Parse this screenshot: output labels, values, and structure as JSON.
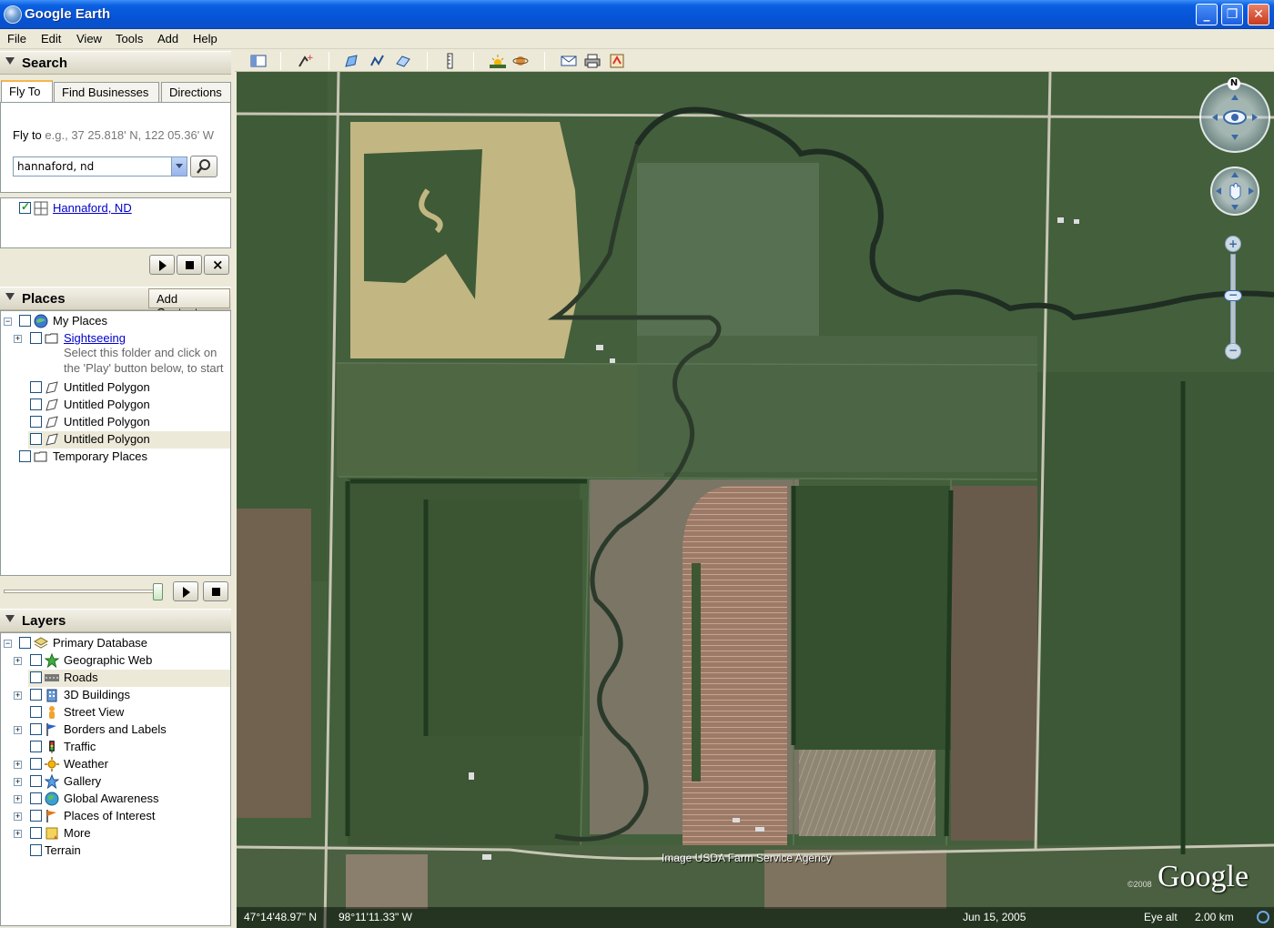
{
  "window": {
    "title": "Google Earth",
    "minimize": "_",
    "maximize": "❐",
    "close": "✕"
  },
  "menu": [
    "File",
    "Edit",
    "View",
    "Tools",
    "Add",
    "Help"
  ],
  "search": {
    "header": "Search",
    "tabs": [
      "Fly To",
      "Find Businesses",
      "Directions"
    ],
    "fly_to_label": "Fly to",
    "fly_to_hint": "e.g., 37 25.818' N, 122 05.36' W",
    "input_value": "hannaford, nd",
    "result": "Hannaford, ND"
  },
  "places": {
    "header": "Places",
    "add_content": "Add Content",
    "items": {
      "my_places": "My Places",
      "sightseeing": "Sightseeing",
      "sightseeing_desc_1": "Select this folder and click on",
      "sightseeing_desc_2": "the 'Play' button below, to start",
      "polygon_1": "Untitled Polygon",
      "polygon_2": "Untitled Polygon",
      "polygon_3": "Untitled Polygon",
      "polygon_4": "Untitled Polygon",
      "temporary": "Temporary Places"
    }
  },
  "layers": {
    "header": "Layers",
    "items": {
      "primary": "Primary Database",
      "geo_web": "Geographic Web",
      "roads": "Roads",
      "buildings": "3D Buildings",
      "street_view": "Street View",
      "borders": "Borders and Labels",
      "traffic": "Traffic",
      "weather": "Weather",
      "gallery": "Gallery",
      "global": "Global Awareness",
      "poi": "Places of Interest",
      "more": "More",
      "terrain": "Terrain"
    }
  },
  "map": {
    "attribution": "Image USDA Farm Service Agency",
    "copyright": "©2008",
    "logo": "Google",
    "compass_north": "N",
    "lat": "47°14'48.97\" N",
    "lon": "98°11'11.33\" W",
    "date": "Jun 15, 2005",
    "eye_alt_label": "Eye alt",
    "eye_alt_value": "2.00 km"
  }
}
